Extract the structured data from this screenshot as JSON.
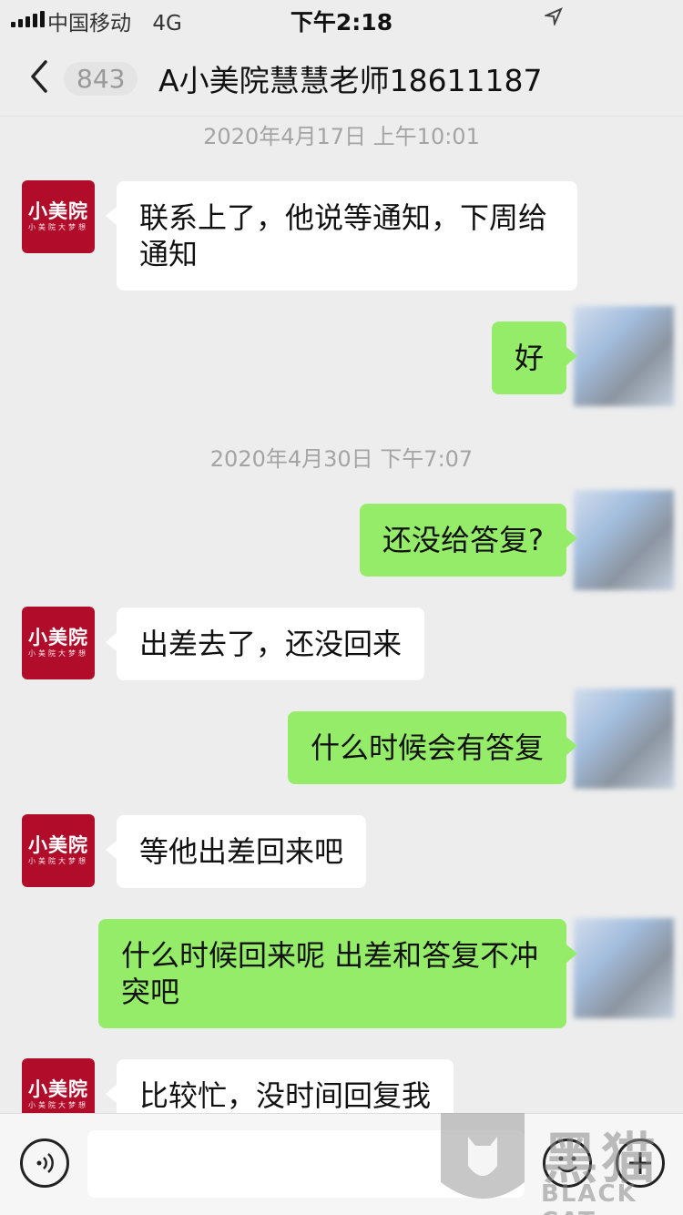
{
  "status_bar": {
    "carrier": "中国移动",
    "network": "4G",
    "time": "下午2:18"
  },
  "nav": {
    "unread_count": "843",
    "title": "A小美院慧慧老师18611187."
  },
  "avatar": {
    "logo_main": "小美院",
    "logo_sub": "小美院大梦想"
  },
  "messages": [
    {
      "type": "timestamp",
      "text": "2020年4月17日 上午10:01"
    },
    {
      "type": "incoming",
      "text": "联系上了，他说等通知，下周给通知"
    },
    {
      "type": "outgoing",
      "text": "好"
    },
    {
      "type": "timestamp",
      "text": "2020年4月30日 下午7:07"
    },
    {
      "type": "outgoing",
      "text": "还没给答复?"
    },
    {
      "type": "incoming",
      "text": "出差去了，还没回来"
    },
    {
      "type": "outgoing",
      "text": "什么时候会有答复"
    },
    {
      "type": "incoming",
      "text": "等他出差回来吧"
    },
    {
      "type": "outgoing",
      "text": "什么时候回来呢 出差和答复不冲突吧"
    },
    {
      "type": "incoming",
      "text": "比较忙，没时间回复我"
    }
  ],
  "watermark": {
    "main": "黑猫",
    "sub": "BLACK CAT"
  },
  "colors": {
    "background": "#ededed",
    "outgoing_bubble": "#95ec69",
    "incoming_bubble": "#ffffff",
    "avatar_brand": "#b10d2b"
  },
  "icons": [
    "back-chevron-icon",
    "location-arrow-icon",
    "voice-icon",
    "emoji-icon",
    "plus-icon"
  ]
}
